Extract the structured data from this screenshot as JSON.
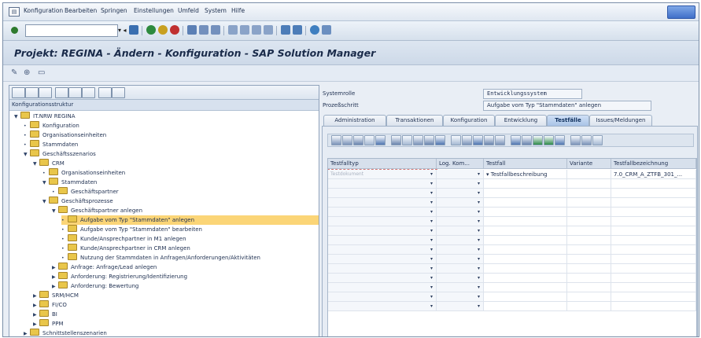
{
  "menubar": {
    "items": [
      "Konfiguration",
      "Bearbeiten",
      "Springen",
      "Einstellungen",
      "Umfeld",
      "System",
      "Hilfe"
    ]
  },
  "title": "Projekt: REGINA - Ändern - Konfiguration - SAP Solution Manager",
  "left": {
    "header": "Konfigurationsstruktur",
    "tree": [
      {
        "label": "IT.NRW REGINA",
        "level": 0,
        "exp": "▼",
        "icon": "folder"
      },
      {
        "label": "Konfiguration",
        "level": 1,
        "exp": "•",
        "icon": "folder"
      },
      {
        "label": "Organisationseinheiten",
        "level": 1,
        "exp": "•",
        "icon": "folder"
      },
      {
        "label": "Stammdaten",
        "level": 1,
        "exp": "•",
        "icon": "folder"
      },
      {
        "label": "Geschäftsszenarios",
        "level": 1,
        "exp": "▼",
        "icon": "folder"
      },
      {
        "label": "CRM",
        "level": 2,
        "exp": "▼",
        "icon": "folder"
      },
      {
        "label": "Organisationseinheiten",
        "level": 3,
        "exp": "•",
        "icon": "folder"
      },
      {
        "label": "Stammdaten",
        "level": 3,
        "exp": "▼",
        "icon": "folder"
      },
      {
        "label": "Geschäftspartner",
        "level": 4,
        "exp": "•",
        "icon": "folder"
      },
      {
        "label": "Geschäftsprozesse",
        "level": 3,
        "exp": "▼",
        "icon": "folder"
      },
      {
        "label": "Geschäftspartner anlegen",
        "level": 4,
        "exp": "▼",
        "icon": "folder"
      },
      {
        "label": "Aufgabe vom Typ \"Stammdaten\" anlegen",
        "level": 5,
        "exp": "•",
        "icon": "folder",
        "selected": true
      },
      {
        "label": "Aufgabe vom Typ \"Stammdaten\" bearbeiten",
        "level": 5,
        "exp": "•",
        "icon": "folder"
      },
      {
        "label": "Kunde/Ansprechpartner in M1 anlegen",
        "level": 5,
        "exp": "•",
        "icon": "folder"
      },
      {
        "label": "Kunde/Ansprechpartner in CRM anlegen",
        "level": 5,
        "exp": "•",
        "icon": "folder"
      },
      {
        "label": "Nutzung der Stammdaten in Anfragen/Anforderungen/Aktivitäten",
        "level": 5,
        "exp": "•",
        "icon": "folder"
      },
      {
        "label": "Anfrage: Anfrage/Lead anlegen",
        "level": 4,
        "exp": "▶",
        "icon": "folder"
      },
      {
        "label": "Anforderung: Registrierung/Identifizierung",
        "level": 4,
        "exp": "▶",
        "icon": "folder"
      },
      {
        "label": "Anforderung: Bewertung",
        "level": 4,
        "exp": "▶",
        "icon": "folder"
      },
      {
        "label": "SRM/HCM",
        "level": 2,
        "exp": "▶",
        "icon": "folder"
      },
      {
        "label": "FI/CO",
        "level": 2,
        "exp": "▶",
        "icon": "folder"
      },
      {
        "label": "BI",
        "level": 2,
        "exp": "▶",
        "icon": "folder"
      },
      {
        "label": "PPM",
        "level": 2,
        "exp": "▶",
        "icon": "folder"
      },
      {
        "label": "Schnittstellenszenarien",
        "level": 1,
        "exp": "▶",
        "icon": "folder"
      }
    ]
  },
  "right": {
    "systemrolle_label": "Systemrolle",
    "systemrolle_value": "Entwicklungssystem",
    "prozessschritt_label": "Prozeßschritt",
    "prozessschritt_value": "Aufgabe vom Typ \"Stammdaten\" anlegen",
    "tabs": [
      {
        "label": "Administration",
        "active": false
      },
      {
        "label": "Transaktionen",
        "active": false
      },
      {
        "label": "Konfiguration",
        "active": false
      },
      {
        "label": "Entwicklung",
        "active": false
      },
      {
        "label": "Testfälle",
        "active": true
      },
      {
        "label": "Issues/Meldungen",
        "active": false
      }
    ],
    "grid": {
      "columns": [
        "Testfalltyp",
        "Log. Kom...",
        "Testfall",
        "Variante",
        "Testfallbezeichnung"
      ],
      "rows": [
        [
          "Testdokument",
          "",
          "Testfallbeschreibung",
          "",
          "7.0_CRM_A_ZTFB_301_..."
        ]
      ],
      "empty_rows": 14
    }
  }
}
